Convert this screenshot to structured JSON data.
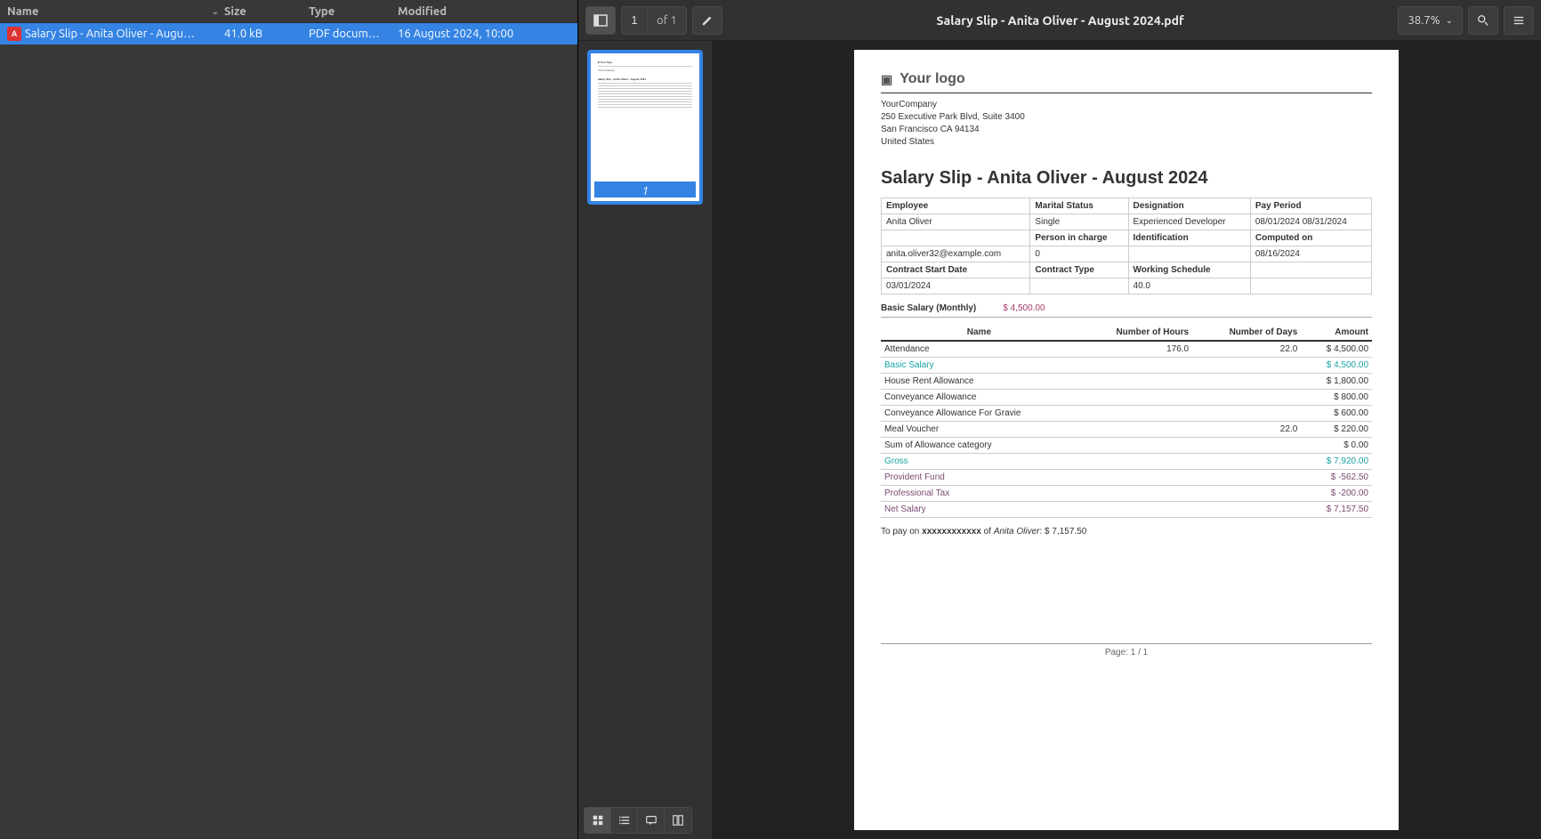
{
  "file_list": {
    "headers": {
      "name": "Name",
      "size": "Size",
      "type": "Type",
      "modified": "Modified"
    },
    "row": {
      "name": "Salary Slip - Anita Oliver - Augu…",
      "size": "41.0 kB",
      "type": "PDF docum…",
      "modified": "16 August 2024, 10:00"
    }
  },
  "toolbar": {
    "page_current": "1",
    "page_total": "of 1",
    "title": "Salary Slip - Anita Oliver - August 2024.pdf",
    "zoom": "38.7%"
  },
  "thumb": {
    "num": "1"
  },
  "doc": {
    "logo_text": "Your logo",
    "company": {
      "name": "YourCompany",
      "addr1": "250 Executive Park Blvd, Suite 3400",
      "addr2": "San Francisco CA 94134",
      "country": "United States"
    },
    "title": "Salary Slip - Anita Oliver - August 2024",
    "info_headers": {
      "employee": "Employee",
      "marital": "Marital Status",
      "designation": "Designation",
      "period": "Pay Period",
      "person": "Person in charge",
      "identification": "Identification",
      "computed": "Computed on",
      "cstart": "Contract Start Date",
      "ctype": "Contract Type",
      "schedule": "Working Schedule"
    },
    "info": {
      "employee": "Anita Oliver",
      "marital": "Single",
      "designation": "Experienced Developer",
      "period": "08/01/2024 08/31/2024",
      "email": "anita.oliver32@example.com",
      "person": "0",
      "identification": "",
      "computed": "08/16/2024",
      "cstart": "03/01/2024",
      "ctype": "",
      "schedule": "40.0",
      "blank": ""
    },
    "basic": {
      "label": "Basic Salary (Monthly)",
      "value": "$ 4,500.00"
    },
    "line_headers": {
      "name": "Name",
      "hours": "Number of Hours",
      "days": "Number of Days",
      "amount": "Amount"
    },
    "lines": [
      {
        "name": "Attendance",
        "hours": "176.0",
        "days": "22.0",
        "amount": "$ 4,500.00",
        "cls": ""
      },
      {
        "name": "Basic Salary",
        "hours": "",
        "days": "",
        "amount": "$ 4,500.00",
        "cls": "teal"
      },
      {
        "name": "House Rent Allowance",
        "hours": "",
        "days": "",
        "amount": "$ 1,800.00",
        "cls": ""
      },
      {
        "name": "Conveyance Allowance",
        "hours": "",
        "days": "",
        "amount": "$ 800.00",
        "cls": ""
      },
      {
        "name": "Conveyance Allowance For Gravie",
        "hours": "",
        "days": "",
        "amount": "$ 600.00",
        "cls": ""
      },
      {
        "name": "Meal Voucher",
        "hours": "",
        "days": "22.0",
        "amount": "$ 220.00",
        "cls": ""
      },
      {
        "name": "Sum of Allowance category",
        "hours": "",
        "days": "",
        "amount": "$ 0.00",
        "cls": ""
      },
      {
        "name": "Gross",
        "hours": "",
        "days": "",
        "amount": "$ 7,920.00",
        "cls": "teal"
      },
      {
        "name": "Provident Fund",
        "hours": "",
        "days": "",
        "amount": "$ -562.50",
        "cls": "purple"
      },
      {
        "name": "Professional Tax",
        "hours": "",
        "days": "",
        "amount": "$ -200.00",
        "cls": "purple"
      },
      {
        "name": "Net Salary",
        "hours": "",
        "days": "",
        "amount": "$ 7,157.50",
        "cls": "purple"
      }
    ],
    "pay_prefix": "To pay on ",
    "pay_account": "xxxxxxxxxxxx",
    "pay_of": " of ",
    "pay_name": "Anita Oliver",
    "pay_amount": ": $ 7,157.50",
    "page_footer": "Page: 1 / 1"
  }
}
